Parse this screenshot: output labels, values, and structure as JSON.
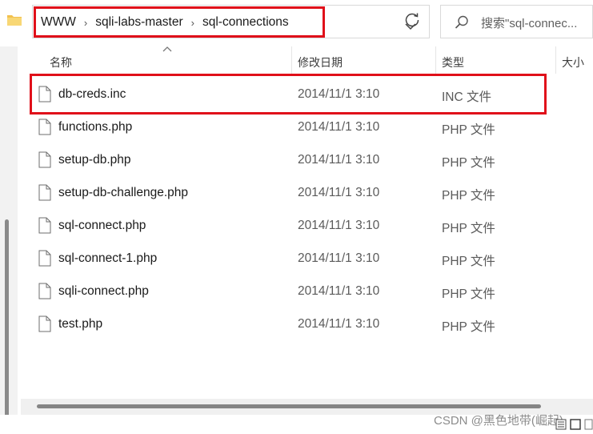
{
  "address": {
    "crumbs": [
      "WWW",
      "sqli-labs-master",
      "sql-connections"
    ],
    "separator": "›"
  },
  "search": {
    "placeholder": "搜索\"sql-connec..."
  },
  "columns": {
    "name": "名称",
    "date": "修改日期",
    "type": "类型",
    "size": "大小"
  },
  "files": [
    {
      "name": "db-creds.inc",
      "date": "2014/11/1 3:10",
      "type": "INC 文件"
    },
    {
      "name": "functions.php",
      "date": "2014/11/1 3:10",
      "type": "PHP 文件"
    },
    {
      "name": "setup-db.php",
      "date": "2014/11/1 3:10",
      "type": "PHP 文件"
    },
    {
      "name": "setup-db-challenge.php",
      "date": "2014/11/1 3:10",
      "type": "PHP 文件"
    },
    {
      "name": "sql-connect.php",
      "date": "2014/11/1 3:10",
      "type": "PHP 文件"
    },
    {
      "name": "sql-connect-1.php",
      "date": "2014/11/1 3:10",
      "type": "PHP 文件"
    },
    {
      "name": "sqli-connect.php",
      "date": "2014/11/1 3:10",
      "type": "PHP 文件"
    },
    {
      "name": "test.php",
      "date": "2014/11/1 3:10",
      "type": "PHP 文件"
    }
  ],
  "watermark": "CSDN @黑色地带(崛起)",
  "colors": {
    "highlight": "#e0101a",
    "folder": "#f2c14e"
  }
}
